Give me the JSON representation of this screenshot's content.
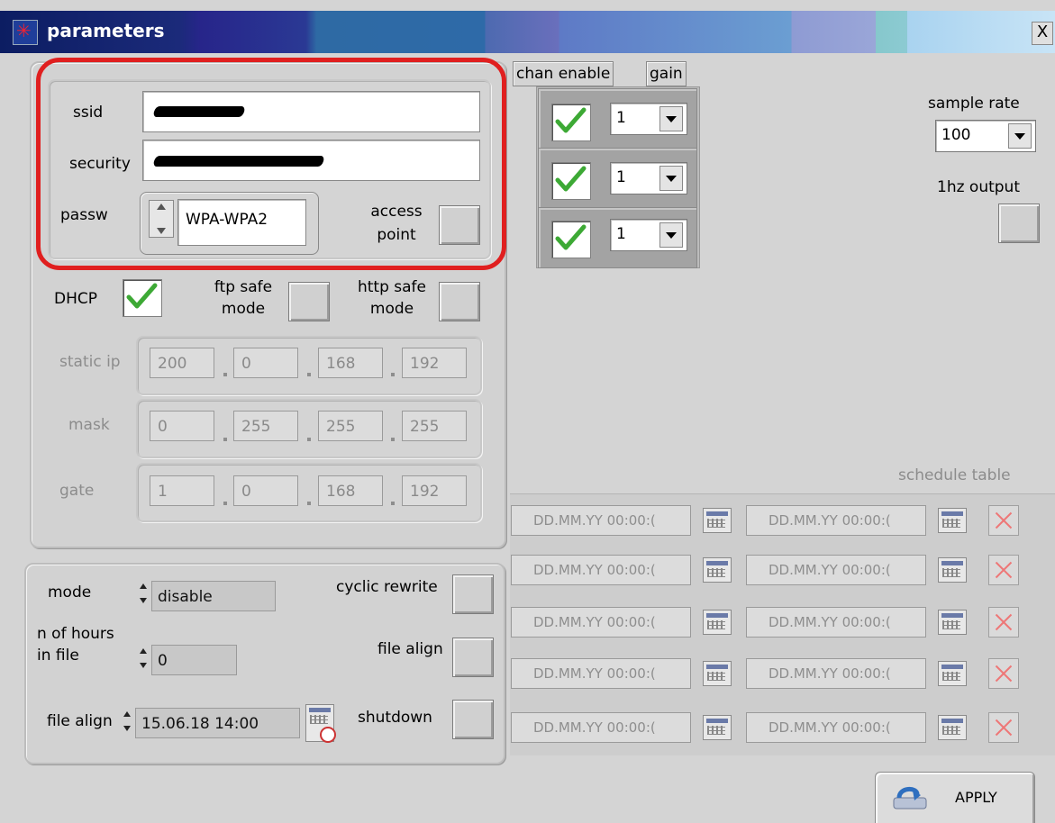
{
  "window": {
    "title": "parameters",
    "close_label": "X"
  },
  "wifi": {
    "ssid_label": "ssid",
    "security_label": "security",
    "passw_label": "passw",
    "passw_value": "WPA-WPA2",
    "access_point_line1": "access",
    "access_point_line2": "point"
  },
  "network": {
    "dhcp_label": "DHCP",
    "dhcp_checked": true,
    "ftp_line1": "ftp safe",
    "ftp_line2": "mode",
    "http_line1": "http safe",
    "http_line2": "mode",
    "static_ip_label": "static ip",
    "mask_label": "mask",
    "gate_label": "gate",
    "static_ip": [
      "200",
      "0",
      "168",
      "192"
    ],
    "mask": [
      "0",
      "255",
      "255",
      "255"
    ],
    "gate": [
      "1",
      "0",
      "168",
      "192"
    ]
  },
  "recording": {
    "mode_label": "mode",
    "mode_value": "disable",
    "hours_line1": "n of hours",
    "hours_line2": "in file",
    "hours_value": "0",
    "file_align_label": "file align",
    "file_align_value": "15.06.18 14:00",
    "cyclic_rewrite_label": "cyclic rewrite",
    "file_align_toggle_label": "file align",
    "shutdown_label": "shutdown"
  },
  "channels": {
    "chan_enable_tab": "chan enable",
    "gain_tab": "gain",
    "gains": [
      "1",
      "1",
      "1"
    ]
  },
  "sample_rate": {
    "label": "sample rate",
    "value": "100"
  },
  "output_1hz": {
    "label": "1hz output"
  },
  "schedule": {
    "label": "schedule table",
    "placeholder": "DD.MM.YY 00:00:(",
    "rows": 5
  },
  "apply_label": "APPLY"
}
